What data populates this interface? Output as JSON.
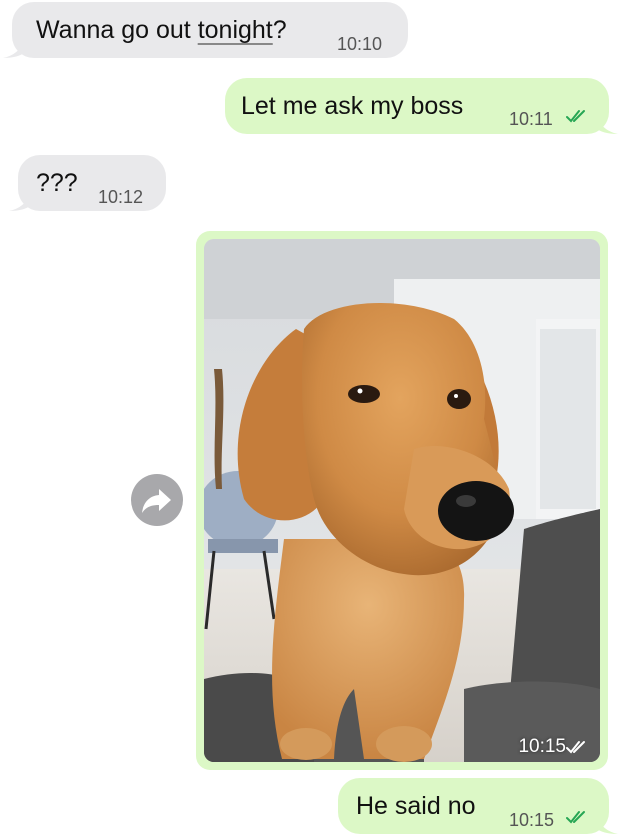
{
  "messages": [
    {
      "text": "Wanna go out ",
      "text_underlined": "tonight",
      "text_end": "?",
      "time": "10:10"
    },
    {
      "text": "Let me ask my boss",
      "time": "10:11"
    },
    {
      "text": "???",
      "time": "10:12"
    },
    {
      "image": "golden-retriever-photo",
      "time": "10:15"
    },
    {
      "text": "He said no",
      "time": "10:15"
    }
  ],
  "colors": {
    "incoming_bubble": "#e9e9eb",
    "outgoing_bubble": "#dcf8c6",
    "read_ticks": "#34b7f1"
  },
  "icons": {
    "forward": "forward-arrow-icon",
    "read": "double-check-icon"
  }
}
